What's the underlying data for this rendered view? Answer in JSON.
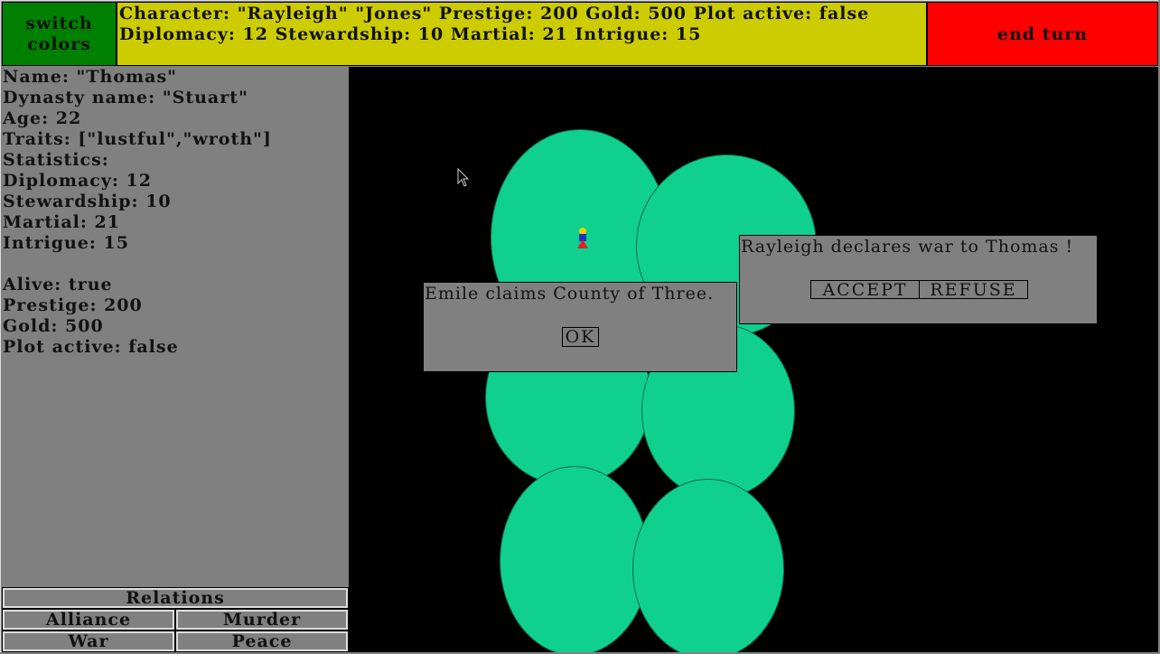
{
  "topbar": {
    "switch_label_line1": "switch",
    "switch_label_line2": "colors",
    "info_line1": "Character: \"Rayleigh\" \"Jones\" Prestige: 200 Gold: 500 Plot active: false",
    "info_line2": "Diplomacy: 12 Stewardship: 10 Martial: 21 Intrigue: 15",
    "end_turn_label": "end turn",
    "colors": {
      "switch": "#008000",
      "info": "#cccc00",
      "end_turn": "#ff0000"
    }
  },
  "character_panel": {
    "lines": [
      "Name: \"Thomas\"",
      "Dynasty name: \"Stuart\"",
      "Age: 22",
      "Traits: [\"lustful\",\"wroth\"]",
      "Statistics:",
      "Diplomacy: 12",
      "Stewardship: 10",
      "Martial: 21",
      "Intrigue: 15",
      "",
      "Alive: true",
      "Prestige: 200",
      "Gold: 500",
      "Plot active: false"
    ]
  },
  "relations": {
    "header": "Relations",
    "alliance": "Alliance",
    "murder": "Murder",
    "war": "War",
    "peace": "Peace"
  },
  "map": {
    "background": "#000000",
    "county_color": "#10d090",
    "unit_icon": "character-unit-icon"
  },
  "dialogs": {
    "claim": {
      "message": "Emile claims County of Three.",
      "ok_label": "OK"
    },
    "war": {
      "message": "Rayleigh declares war to Thomas !",
      "accept_label": "ACCEPT",
      "refuse_label": "REFUSE"
    }
  },
  "cursor_icon": "mouse-pointer-icon"
}
